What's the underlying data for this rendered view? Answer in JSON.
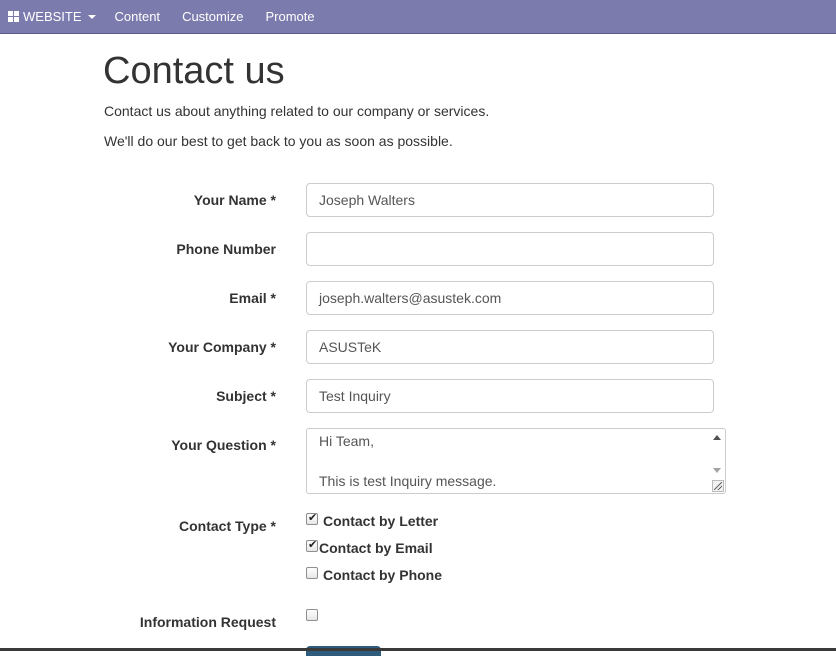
{
  "topbar": {
    "website_label": "WEBSITE",
    "content_label": "Content",
    "customize_label": "Customize",
    "promote_label": "Promote",
    "bg_color": "#7c7bad"
  },
  "page": {
    "title": "Contact us",
    "intro_line1": "Contact us about anything related to our company or services.",
    "intro_line2": "We'll do our best to get back to you as soon as possible."
  },
  "form": {
    "name_label": "Your Name *",
    "name_value": "Joseph Walters",
    "phone_label": "Phone Number",
    "phone_value": "",
    "email_label": "Email *",
    "email_value": "joseph.walters@asustek.com",
    "company_label": "Your Company *",
    "company_value": "ASUSTeK",
    "subject_label": "Subject *",
    "subject_value": "Test Inquiry",
    "question_label": "Your Question *",
    "question_value": "Hi Team,\n\nThis is test Inquiry message.",
    "contact_type_label": "Contact Type *",
    "contact_options": [
      {
        "label": "Contact by Letter",
        "checked": true
      },
      {
        "label": "Contact by Email",
        "checked": true
      },
      {
        "label": "Contact by Phone",
        "checked": false
      }
    ],
    "info_request_label": "Information Request",
    "info_request_checked": false
  }
}
